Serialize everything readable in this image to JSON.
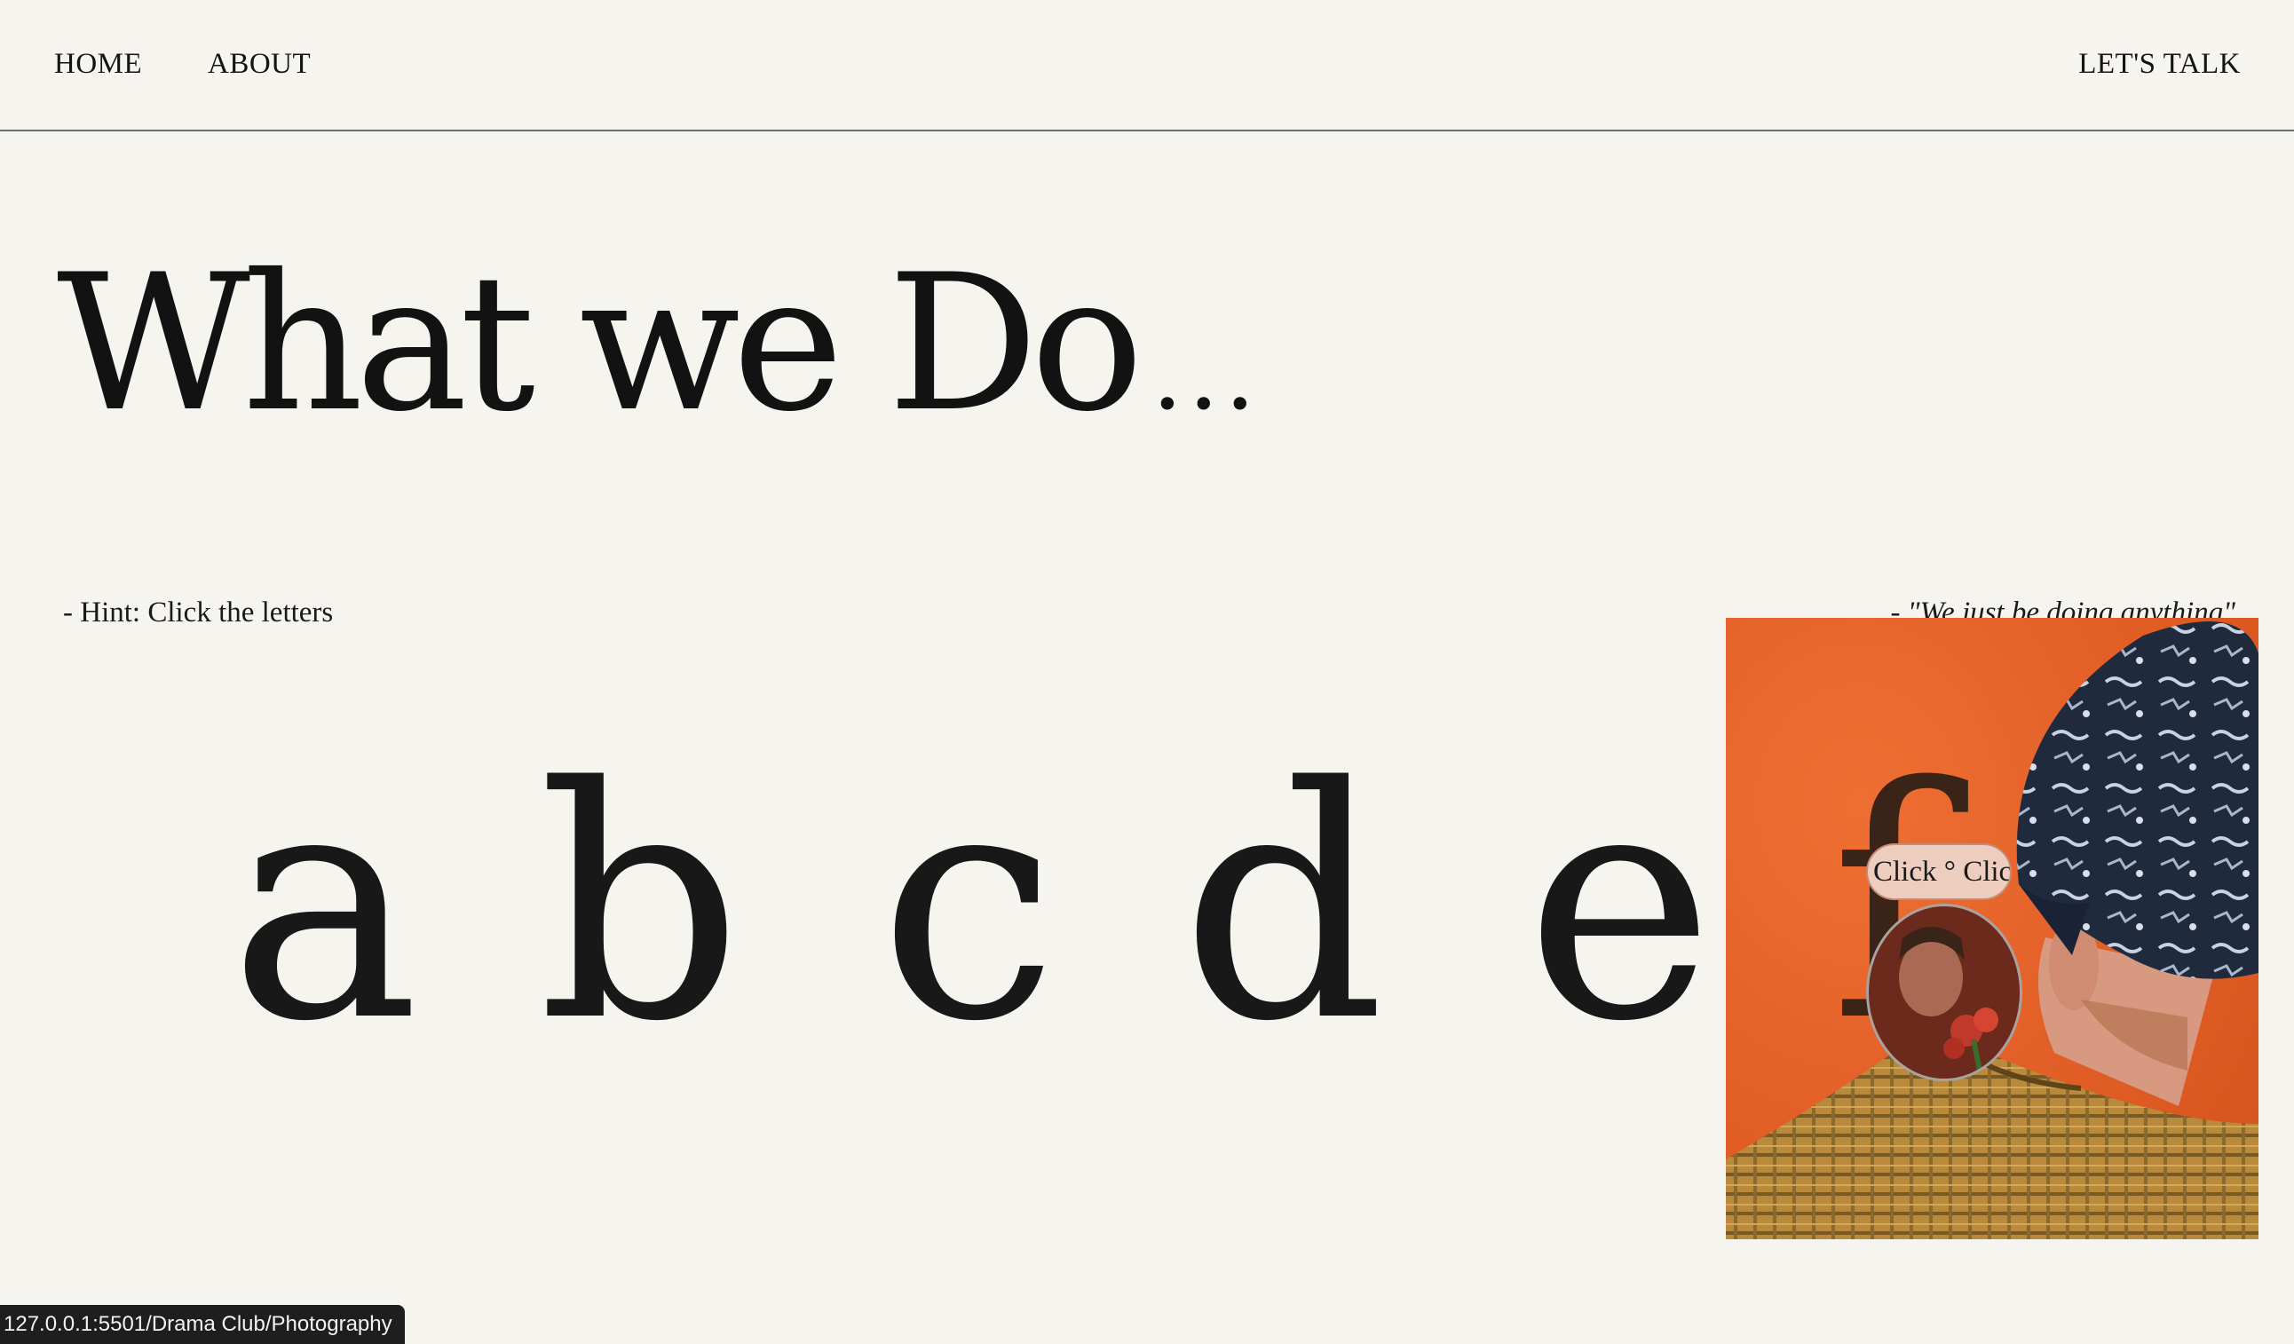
{
  "nav": {
    "home": "HOME",
    "about": "ABOUT",
    "cta": "LET'S TALK"
  },
  "hero": {
    "title": "What we Do",
    "title_suffix": "..."
  },
  "hint": "- Hint: Click the letters",
  "quote": "- \"We just be doing anything\"",
  "letters": [
    "a",
    "b",
    "c",
    "d",
    "e",
    "f"
  ],
  "overlay": {
    "pill_label": "Click ° Click",
    "accent_color": "#e2622a"
  },
  "status_url": "127.0.0.1:5501/Drama Club/Photography"
}
